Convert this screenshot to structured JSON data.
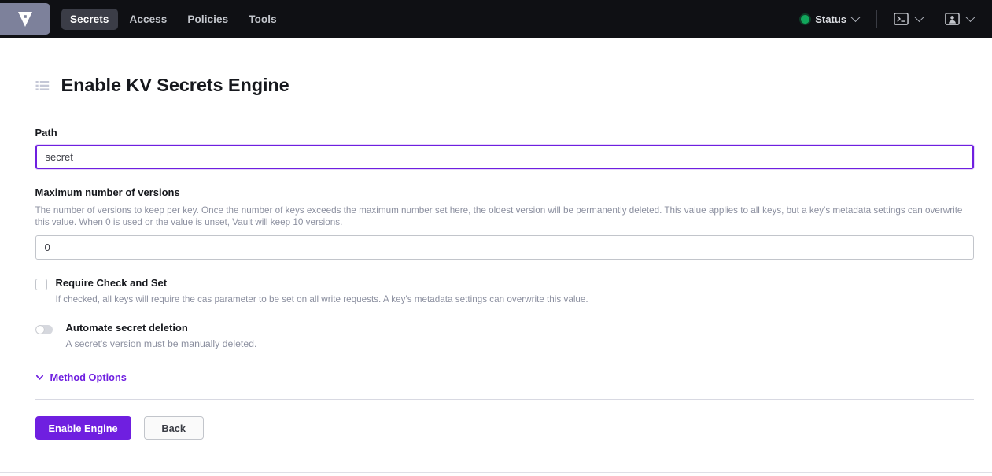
{
  "navbar": {
    "logo_icon": "vault-logo-icon",
    "links": [
      {
        "label": "Secrets",
        "active": true
      },
      {
        "label": "Access",
        "active": false
      },
      {
        "label": "Policies",
        "active": false
      },
      {
        "label": "Tools",
        "active": false
      }
    ],
    "status": {
      "label": "Status",
      "dot_color": "#11a65b",
      "chevron_icon": "chevron-down-icon"
    },
    "console_icon": "terminal-icon",
    "console_chevron_icon": "chevron-down-icon",
    "user_icon": "user-icon",
    "user_chevron_icon": "chevron-down-icon"
  },
  "page": {
    "icon": "list-icon",
    "title": "Enable KV Secrets Engine"
  },
  "form": {
    "path": {
      "label": "Path",
      "value": "secret",
      "placeholder": "path"
    },
    "max_versions": {
      "label": "Maximum number of versions",
      "help": "The number of versions to keep per key. Once the number of keys exceeds the maximum number set here, the oldest version will be permanently deleted. This value applies to all keys, but a key's metadata settings can overwrite this value. When 0 is used or the value is unset, Vault will keep 10 versions.",
      "value": "0",
      "placeholder": "0"
    },
    "require_check_and_set": {
      "label": "Require Check and Set",
      "help": "If checked, all keys will require the cas parameter to be set on all write requests. A key's metadata settings can overwrite this value.",
      "checked": false
    },
    "automate_secret_deletion": {
      "label": "Automate secret deletion",
      "help": "A secret's version must be manually deleted.",
      "enabled": false
    },
    "method_options": {
      "label": "Method Options",
      "chevron_icon": "chevron-down-icon",
      "expanded": false
    }
  },
  "actions": {
    "submit_label": "Enable Engine",
    "back_label": "Back"
  },
  "colors": {
    "accent": "#6f1fe0",
    "navbar_bg": "#0f1014",
    "status_green": "#11a65b",
    "logo_bg": "#7d819b"
  }
}
